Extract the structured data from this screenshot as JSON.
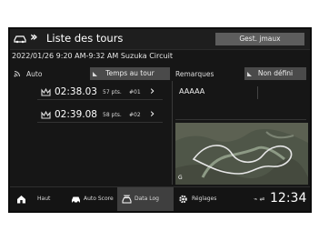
{
  "header": {
    "title": "Liste des tours",
    "gest_button": "Gest. jmaux",
    "app_icon": "car-icon",
    "nav_icon": "double-chevron-icon"
  },
  "session": {
    "info": "2022/01/26 9:20 AM-9:32 AM Suzuka Circuit"
  },
  "mode": {
    "label": "Auto",
    "icon": "signal-icon",
    "temps_button": "Temps au tour"
  },
  "remarks": {
    "label": "Remarques",
    "button": "Non défini",
    "text": "AAAAA"
  },
  "laps": [
    {
      "icon": "crown-icon",
      "time": "02:38.03",
      "points": "57 pts.",
      "number": "#01"
    },
    {
      "icon": "crown-icon",
      "time": "02:39.08",
      "points": "58 pts.",
      "number": "#02"
    }
  ],
  "map": {
    "label": "G"
  },
  "nav": {
    "items": [
      {
        "icon": "home-icon",
        "label": "Haut"
      },
      {
        "icon": "car-icon",
        "label": "Auto Score"
      },
      {
        "icon": "data-log-icon",
        "label": "Data Log"
      },
      {
        "icon": "gear-icon",
        "label": "Réglages"
      }
    ],
    "active_index": 2,
    "status": "⌁ ⇌",
    "clock": "12:34"
  },
  "colors": {
    "screen_bg": "#161616",
    "button_bg": "#4a4a4a",
    "header_button_bg": "#5d5d5d"
  }
}
